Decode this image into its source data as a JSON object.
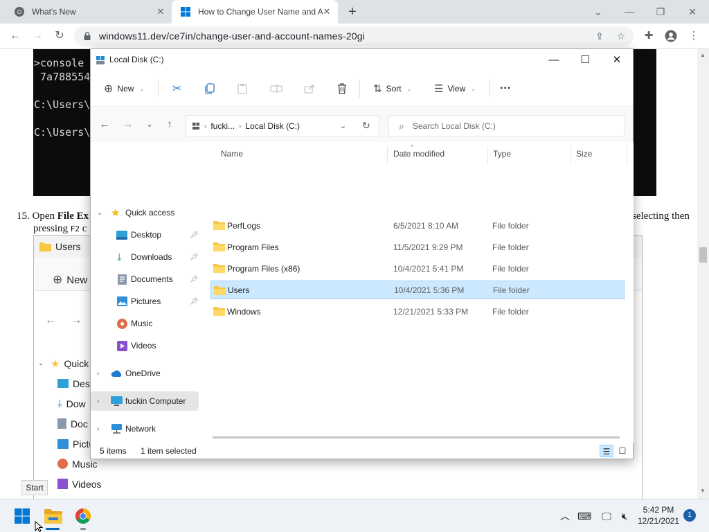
{
  "browser": {
    "tabs": [
      {
        "title": "What's New",
        "favicon": "chrome-icon"
      },
      {
        "title": "How to Change User Name and A",
        "favicon": "windows-logo-icon"
      }
    ],
    "url": "windows11.dev/ce7in/change-user-and-account-names-20gi"
  },
  "webpage": {
    "console_lines": [
      ">console",
      " 7a788554",
      "",
      "C:\\Users\\",
      "",
      "C:\\Users\\"
    ],
    "step_number": "15.",
    "step_open": "Open ",
    "step_bold": "File Ex",
    "step_right": "selecting then",
    "step_pressing": "pressing ",
    "step_key": "F2",
    "step_tail": " c",
    "shot_title": "Users",
    "shot_new": "New",
    "shot_tree": [
      "Quick",
      "Desk",
      "Dow",
      "Doc",
      "Pictu",
      "Music",
      "Videos"
    ]
  },
  "explorer": {
    "title": "Local Disk (C:)",
    "toolbar": {
      "new": "New",
      "sort": "Sort",
      "view": "View",
      "more": "···"
    },
    "address": {
      "crumb1": "fucki...",
      "crumb2": "Local Disk (C:)"
    },
    "search_placeholder": "Search Local Disk (C:)",
    "nav": {
      "quick_access": "Quick access",
      "desktop": "Desktop",
      "downloads": "Downloads",
      "documents": "Documents",
      "pictures": "Pictures",
      "music": "Music",
      "videos": "Videos",
      "onedrive": "OneDrive",
      "this_pc": "fuckin Computer",
      "network": "Network"
    },
    "columns": {
      "name": "Name",
      "date": "Date modified",
      "type": "Type",
      "size": "Size"
    },
    "files": [
      {
        "name": "PerfLogs",
        "date": "6/5/2021 8:10 AM",
        "type": "File folder",
        "selected": false
      },
      {
        "name": "Program Files",
        "date": "11/5/2021 9:29 PM",
        "type": "File folder",
        "selected": false
      },
      {
        "name": "Program Files (x86)",
        "date": "10/4/2021 5:41 PM",
        "type": "File folder",
        "selected": false
      },
      {
        "name": "Users",
        "date": "10/4/2021 5:36 PM",
        "type": "File folder",
        "selected": true
      },
      {
        "name": "Windows",
        "date": "12/21/2021 5:33 PM",
        "type": "File folder",
        "selected": false
      }
    ],
    "status": {
      "count": "5 items",
      "selected": "1 item selected"
    }
  },
  "taskbar": {
    "tooltip": "Start",
    "time": "5:42 PM",
    "date": "12/21/2021",
    "notifications": "1"
  },
  "colors": {
    "accent": "#0067c0",
    "selection": "#cce8ff",
    "folder": "#f8c640",
    "console_bg": "#0c0c0c"
  }
}
